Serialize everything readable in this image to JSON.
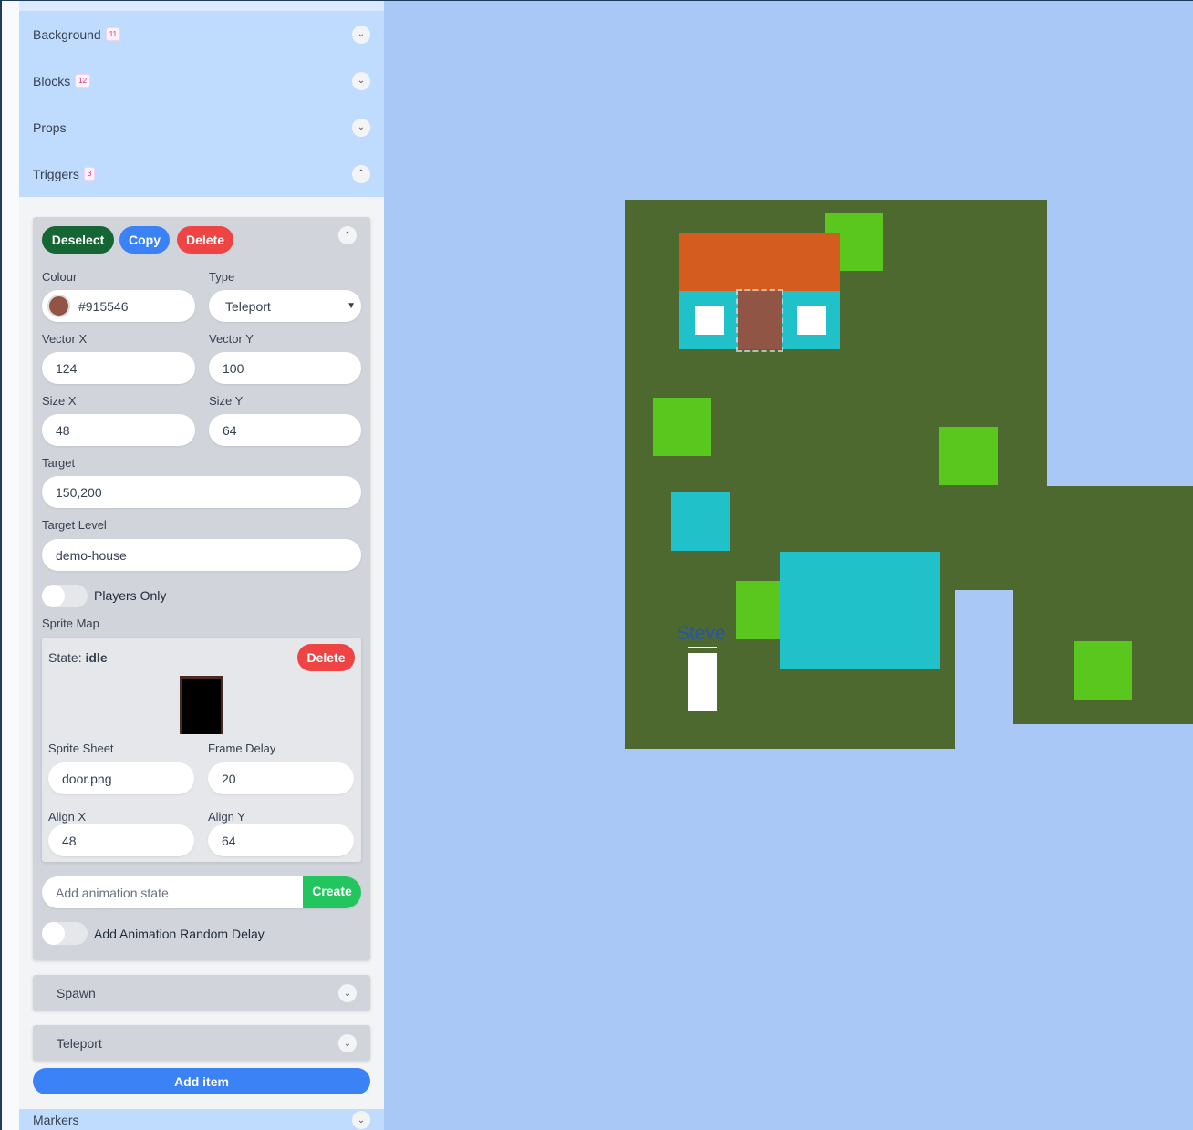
{
  "sidebar": {
    "sections": [
      {
        "label": "Background",
        "count": "11",
        "expanded": false
      },
      {
        "label": "Blocks",
        "count": "12",
        "expanded": false
      },
      {
        "label": "Props",
        "count": "",
        "expanded": false
      },
      {
        "label": "Triggers",
        "count": "3",
        "expanded": true
      }
    ],
    "next_section": "Markers",
    "trigger": {
      "deselect": "Deselect",
      "copy": "Copy",
      "delete": "Delete",
      "colour_label": "Colour",
      "colour_value": "#915546",
      "type_label": "Type",
      "type_value": "Teleport",
      "vector_x_label": "Vector X",
      "vector_x": "124",
      "vector_y_label": "Vector Y",
      "vector_y": "100",
      "size_x_label": "Size X",
      "size_x": "48",
      "size_y_label": "Size Y",
      "size_y": "64",
      "target_label": "Target",
      "target": "150,200",
      "target_level_label": "Target Level",
      "target_level": "demo-house",
      "players_only_label": "Players Only",
      "players_only": false,
      "sprite_map_label": "Sprite Map",
      "state": {
        "prefix": "State:",
        "name": "idle",
        "delete": "Delete",
        "sprite_sheet_label": "Sprite Sheet",
        "sprite_sheet": "door.png",
        "frame_delay_label": "Frame Delay",
        "frame_delay": "20",
        "align_x_label": "Align X",
        "align_x": "48",
        "align_y_label": "Align Y",
        "align_y": "64"
      },
      "add_state_placeholder": "Add animation state",
      "create": "Create",
      "random_delay_label": "Add Animation Random Delay",
      "random_delay": false
    },
    "other_triggers": [
      "Spawn",
      "Teleport"
    ],
    "add_item": "Add item"
  },
  "game": {
    "player_name": "Steve",
    "colors": {
      "ground": "#4d6930",
      "grass": "#5ac71f",
      "roof": "#d35c1e",
      "water": "#20c1c9",
      "door": "#915546",
      "sky": "#a9c8f6"
    }
  }
}
